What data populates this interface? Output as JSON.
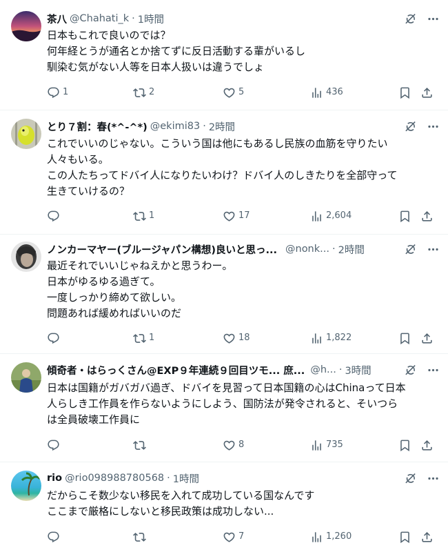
{
  "tweets": [
    {
      "name": "茶八",
      "handle": "@Chahati_k",
      "sep": "·",
      "time": "1時間",
      "lines": [
        "日本もこれで良いのでは？",
        "何年経とうが通名とか捨てずに反日活動する輩がいるし",
        "馴染む気がない人等を日本人扱いは違うでしょ"
      ],
      "replies": "1",
      "reposts": "2",
      "likes": "5",
      "views": "436"
    },
    {
      "name": "とり７割：春(*^-^*)",
      "handle": "@ekimi83",
      "sep": "·",
      "time": "2時間",
      "lines": [
        "これでいいのじゃない。こういう国は他にもあるし民族の血筋を守りたい",
        "人々もいる。",
        "この人たちってドバイ人になりたいわけ？ドバイ人のしきたりを全部守って",
        "生きていけるの？"
      ],
      "replies": "",
      "reposts": "1",
      "likes": "17",
      "views": "2,604"
    },
    {
      "name": "ノンカーマヤー(ブルージャパン構想)良いと思っ...",
      "handle": "@nonk...",
      "sep": "·",
      "time": "2時間",
      "lines": [
        "最近それでいいじゃねえかと思うわー。",
        "日本がゆるゆる過ぎて。",
        "一度しっかり締めて欲しい。",
        "問題あれば緩めればいいのだ"
      ],
      "replies": "",
      "reposts": "1",
      "likes": "18",
      "views": "1,822"
    },
    {
      "name": "傾奇者・はらっくさん@EXP９年連続９回目ツモ... 庶...",
      "handle": "@h...",
      "sep": "·",
      "time": "3時間",
      "lines": [
        "日本は国籍がガバガバ過ぎ、ドバイを見習って日本国籍の心はChinaって日本",
        "人らしき工作員を作らないようにしよう、国防法が発令されると、そいつら",
        "は全員破壊工作員に"
      ],
      "replies": "",
      "reposts": "",
      "likes": "8",
      "views": "735"
    },
    {
      "name": "rio",
      "handle": "@rio098988780568",
      "sep": "·",
      "time": "1時間",
      "lines": [
        "だからこそ数少ない移民を入れて成功している国なんです",
        "ここまで厳格にしないと移民政策は成功しない..."
      ],
      "replies": "",
      "reposts": "",
      "likes": "7",
      "views": "1,260"
    }
  ],
  "icons": {
    "grok": "grok-icon",
    "more": "more-icon",
    "reply": "reply-icon",
    "repost": "repost-icon",
    "like": "heart-icon",
    "views": "views-icon",
    "bookmark": "bookmark-icon",
    "share": "share-icon"
  },
  "colors": {
    "text": "#0f1419",
    "secondary": "#536471",
    "divider": "#eff3f4"
  }
}
